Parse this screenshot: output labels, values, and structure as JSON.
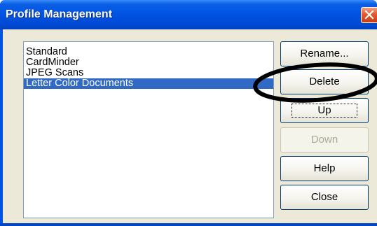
{
  "window": {
    "title": "Profile Management"
  },
  "profiles": {
    "items": [
      {
        "label": "Standard",
        "selected": false
      },
      {
        "label": "CardMinder",
        "selected": false
      },
      {
        "label": "JPEG Scans",
        "selected": false
      },
      {
        "label": "Letter Color Documents",
        "selected": true
      }
    ]
  },
  "buttons": {
    "rename": "Rename...",
    "delete": "Delete",
    "up": "Up",
    "down": "Down",
    "help": "Help",
    "close": "Close"
  },
  "states": {
    "down_disabled": true,
    "up_focused": true
  },
  "colors": {
    "titlebar": "#0054e3",
    "selection": "#316ac5",
    "dialog_bg": "#ece9d8",
    "close_button": "#e2582c",
    "annotation_ellipse": "#000000"
  },
  "icons": {
    "title_close": "close-x-icon"
  }
}
